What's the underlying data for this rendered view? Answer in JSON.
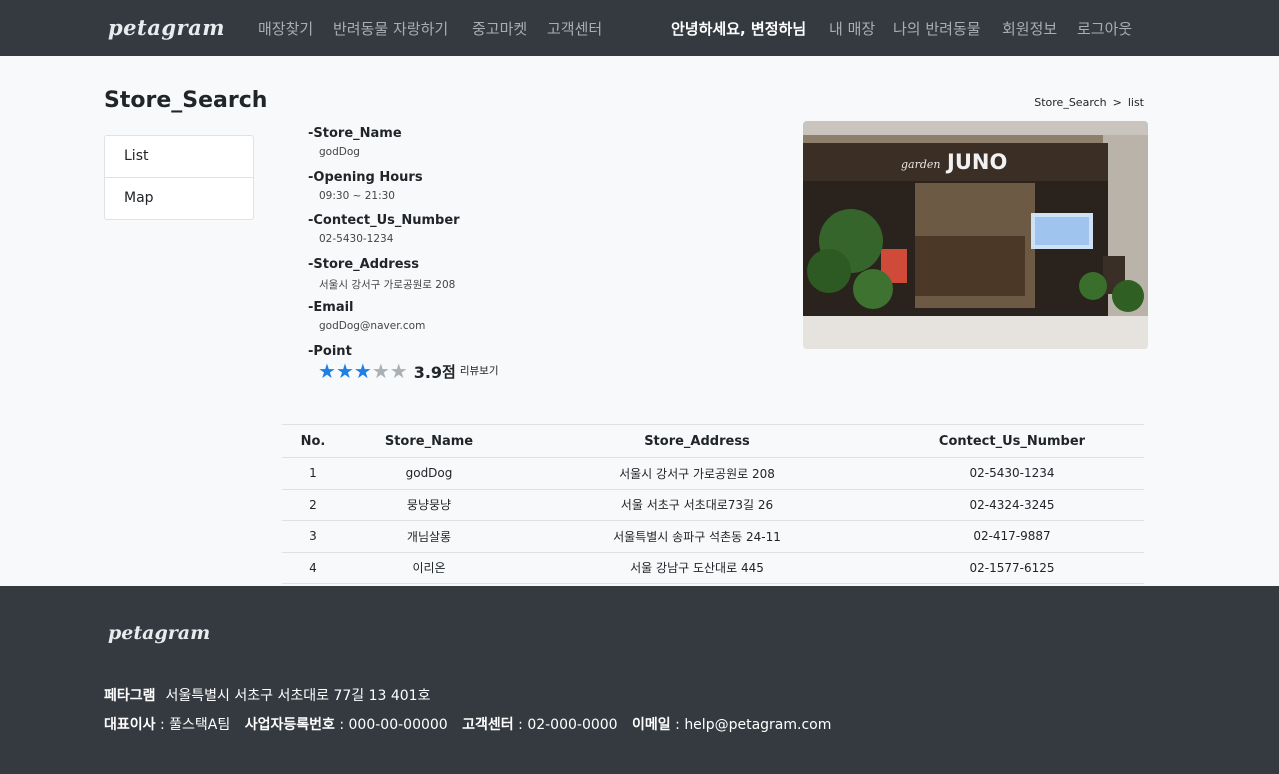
{
  "brand": "petagram",
  "nav": {
    "left": [
      "매장찾기",
      "반려동물 자랑하기",
      "중고마켓",
      "고객센터"
    ],
    "greeting": "안녕하세요, 변정하님",
    "right": [
      "내 매장",
      "나의 반려동물",
      "회원정보",
      "로그아웃"
    ]
  },
  "page_title": "Store_Search",
  "breadcrumb": {
    "parent": "Store_Search",
    "separator": ">",
    "current": "list"
  },
  "sidebar": [
    "List",
    "Map"
  ],
  "store": {
    "name_label": "-Store_Name",
    "name": "godDog",
    "hours_label": "-Opening Hours",
    "hours": "09:30 ~ 21:30",
    "phone_label": "-Contect_Us_Number",
    "phone": "02-5430-1234",
    "address_label": "-Store_Address",
    "address": "서울시 강서구 가로공원로 208",
    "email_label": "-Email",
    "email": "godDog@naver.com",
    "point_label": "-Point",
    "rating": 3.9,
    "rating_max": 5,
    "rating_text": "3.9",
    "rating_unit": "점",
    "review_link": "리뷰보기",
    "sign_text": "JUNO",
    "sign_script": "garden"
  },
  "colors": {
    "nav_bg": "#343a40",
    "star_on": "#1e7fe6",
    "star_off": "#aab0b6",
    "footer_bg": "#343a40"
  },
  "table": {
    "headers": [
      "No.",
      "Store_Name",
      "Store_Address",
      "Contect_Us_Number"
    ],
    "rows": [
      [
        "1",
        "godDog",
        "서울시 강서구 가로공원로 208",
        "02-5430-1234"
      ],
      [
        "2",
        "뭉냥뭉냥",
        "서울 서초구 서초대로73길 26",
        "02-4324-3245"
      ],
      [
        "3",
        "개님살롱",
        "서울특별시 송파구 석촌동 24-11",
        "02-417-9887"
      ],
      [
        "4",
        "이리온",
        "서울 강남구 도산대로 445",
        "02-1577-6125"
      ]
    ]
  },
  "footer": {
    "brand": "petagram",
    "company": "페타그램",
    "address": "서울특별시 서초구 서초대로 77길 13 401호",
    "ceo_label": "대표이사",
    "ceo": "풀스택A팀",
    "biz_label": "사업자등록번호",
    "biz": "000-00-00000",
    "cs_label": "고객센터",
    "cs": "02-000-0000",
    "email_label": "이메일",
    "email": "help@petagram.com",
    "colon": ":"
  }
}
